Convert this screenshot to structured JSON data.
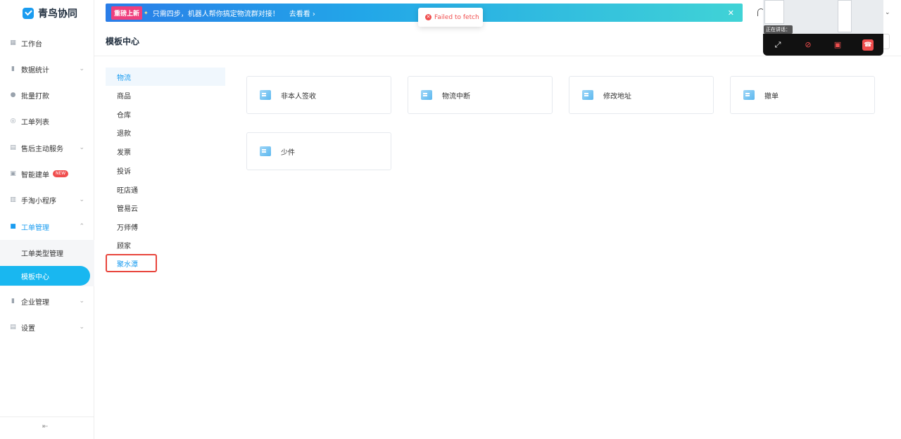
{
  "app": {
    "name": "青鸟协同"
  },
  "sidebar": {
    "items": [
      {
        "label": "工作台",
        "icon": "dashboard-icon"
      },
      {
        "label": "数据统计",
        "icon": "bar-chart-icon"
      },
      {
        "label": "批量打款",
        "icon": "coin-icon"
      },
      {
        "label": "工单列表",
        "icon": "search-list-icon"
      },
      {
        "label": "售后主动服务",
        "icon": "chat-icon"
      },
      {
        "label": "智能建单",
        "icon": "smart-icon",
        "badge": "NEW"
      },
      {
        "label": "手淘小程序",
        "icon": "mini-program-icon"
      },
      {
        "label": "工单管理",
        "icon": "ticket-icon"
      },
      {
        "label": "企业管理",
        "icon": "building-icon"
      },
      {
        "label": "设置",
        "icon": "settings-icon"
      }
    ],
    "submenu": [
      {
        "label": "工单类型管理"
      },
      {
        "label": "模板中心"
      }
    ]
  },
  "banner": {
    "tag": "重磅上新",
    "text": "只需四步，机器人帮你搞定物流群对接！",
    "link": "去看看"
  },
  "toast": {
    "message": "Failed to fetch"
  },
  "page": {
    "title": "模板中心"
  },
  "categories": [
    "物流",
    "商品",
    "仓库",
    "退款",
    "发票",
    "投诉",
    "旺店通",
    "管易云",
    "万师傅",
    "顾家",
    "聚水潭"
  ],
  "templates": [
    "非本人签收",
    "物流中断",
    "修改地址",
    "撤单",
    "少件"
  ],
  "call": {
    "status": "正在讲话："
  },
  "colors": {
    "accent": "#1a9cf0",
    "selected": "#19b7f0",
    "error": "#f04e4e"
  }
}
